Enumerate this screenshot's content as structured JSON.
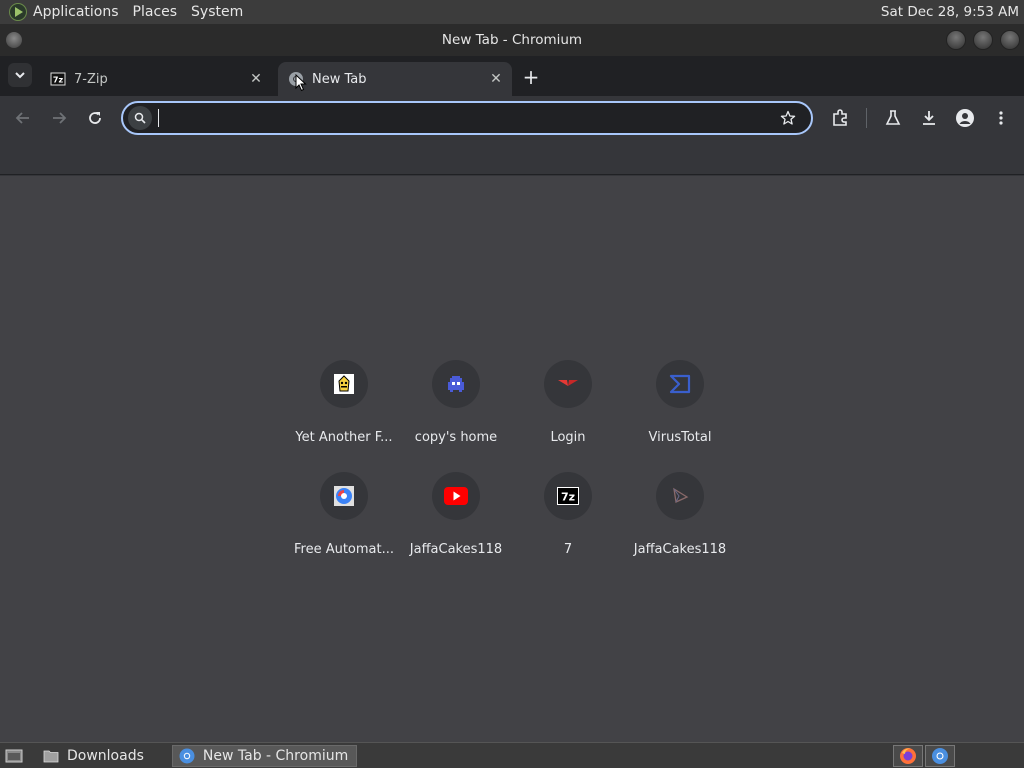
{
  "top_panel": {
    "menus": [
      "Applications",
      "Places",
      "System"
    ],
    "clock": "Sat Dec 28,  9:53 AM"
  },
  "window": {
    "title": "New Tab - Chromium"
  },
  "tabs": [
    {
      "title": "7-Zip",
      "icon": "7zip-icon",
      "active": false
    },
    {
      "title": "New Tab",
      "icon": "chromium-icon",
      "active": true
    }
  ],
  "omnibox": {
    "value": "",
    "placeholder": ""
  },
  "shortcuts": [
    {
      "label": "Yet Another F...",
      "icon": "banana-icon"
    },
    {
      "label": "copy's home",
      "icon": "space-invader-icon"
    },
    {
      "label": "Login",
      "icon": "wing-logo-icon"
    },
    {
      "label": "VirusTotal",
      "icon": "virustotal-icon"
    },
    {
      "label": "Free Automat...",
      "icon": "automation-icon"
    },
    {
      "label": "JaffaCakes118",
      "icon": "youtube-icon"
    },
    {
      "label": "7",
      "icon": "7zip-icon"
    },
    {
      "label": "JaffaCakes118",
      "icon": "play-triangle-icon"
    }
  ],
  "taskbar": {
    "items": [
      {
        "label": "Downloads",
        "icon": "folder-icon",
        "active": false
      },
      {
        "label": "New Tab - Chromium",
        "icon": "chromium-icon",
        "active": true
      }
    ],
    "tray": [
      "firefox-icon",
      "chromium-icon"
    ]
  },
  "colors": {
    "content_bg": "#424246",
    "toolbar_bg": "#35363a",
    "tabstrip_bg": "#202124",
    "focus_ring": "#a8c7fa"
  }
}
